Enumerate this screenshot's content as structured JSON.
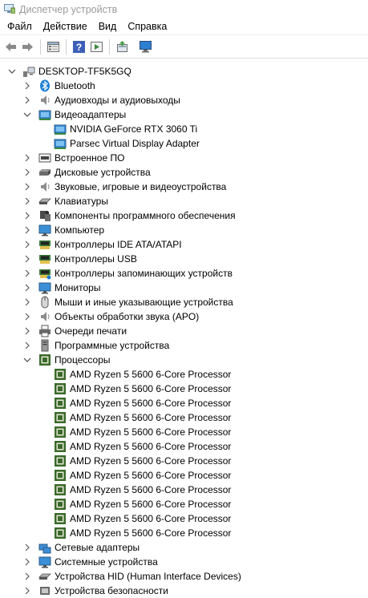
{
  "window": {
    "title": "Диспетчер устройств"
  },
  "menu": [
    "Файл",
    "Действие",
    "Вид",
    "Справка"
  ],
  "toolbar": {
    "buttons": [
      "back-icon",
      "forward-icon",
      "properties-icon",
      "help-icon",
      "show-hidden-icon",
      "update-driver-icon",
      "scan-hardware-icon"
    ]
  },
  "tree": {
    "root": "DESKTOP-TF5K5GQ",
    "categories": [
      {
        "label": "Bluetooth",
        "icon": "bluetooth-icon",
        "expanded": false
      },
      {
        "label": "Аудиовходы и аудиовыходы",
        "icon": "audio-io-icon",
        "expanded": false
      },
      {
        "label": "Видеоадаптеры",
        "icon": "display-adapter-icon",
        "expanded": true,
        "children": [
          "NVIDIA GeForce RTX 3060 Ti",
          "Parsec Virtual Display Adapter"
        ]
      },
      {
        "label": "Встроенное ПО",
        "icon": "firmware-icon",
        "expanded": false
      },
      {
        "label": "Дисковые устройства",
        "icon": "disk-drive-icon",
        "expanded": false
      },
      {
        "label": "Звуковые, игровые и видеоустройства",
        "icon": "sound-icon",
        "expanded": false
      },
      {
        "label": "Клавиатуры",
        "icon": "keyboard-icon",
        "expanded": false
      },
      {
        "label": "Компоненты программного обеспечения",
        "icon": "software-component-icon",
        "expanded": false
      },
      {
        "label": "Компьютер",
        "icon": "computer-icon",
        "expanded": false
      },
      {
        "label": "Контроллеры IDE ATA/ATAPI",
        "icon": "ide-controller-icon",
        "expanded": false
      },
      {
        "label": "Контроллеры USB",
        "icon": "usb-controller-icon",
        "expanded": false
      },
      {
        "label": "Контроллеры запоминающих устройств",
        "icon": "storage-controller-icon",
        "expanded": false
      },
      {
        "label": "Мониторы",
        "icon": "monitor-icon",
        "expanded": false
      },
      {
        "label": "Мыши и иные указывающие устройства",
        "icon": "mouse-icon",
        "expanded": false
      },
      {
        "label": "Объекты обработки звука (APO)",
        "icon": "apo-icon",
        "expanded": false
      },
      {
        "label": "Очереди печати",
        "icon": "printer-icon",
        "expanded": false
      },
      {
        "label": "Программные устройства",
        "icon": "software-device-icon",
        "expanded": false
      },
      {
        "label": "Процессоры",
        "icon": "processor-icon",
        "expanded": true,
        "children": [
          "AMD Ryzen 5 5600 6-Core Processor",
          "AMD Ryzen 5 5600 6-Core Processor",
          "AMD Ryzen 5 5600 6-Core Processor",
          "AMD Ryzen 5 5600 6-Core Processor",
          "AMD Ryzen 5 5600 6-Core Processor",
          "AMD Ryzen 5 5600 6-Core Processor",
          "AMD Ryzen 5 5600 6-Core Processor",
          "AMD Ryzen 5 5600 6-Core Processor",
          "AMD Ryzen 5 5600 6-Core Processor",
          "AMD Ryzen 5 5600 6-Core Processor",
          "AMD Ryzen 5 5600 6-Core Processor",
          "AMD Ryzen 5 5600 6-Core Processor"
        ]
      },
      {
        "label": "Сетевые адаптеры",
        "icon": "network-adapter-icon",
        "expanded": false
      },
      {
        "label": "Системные устройства",
        "icon": "system-device-icon",
        "expanded": false
      },
      {
        "label": "Устройства HID (Human Interface Devices)",
        "icon": "hid-icon",
        "expanded": false
      },
      {
        "label": "Устройства безопасности",
        "icon": "security-device-icon",
        "expanded": false
      }
    ]
  },
  "colors": {
    "title_text": "#9a9a9a",
    "chevron": "#5a5a5a",
    "window_bg": "#ffffff"
  }
}
